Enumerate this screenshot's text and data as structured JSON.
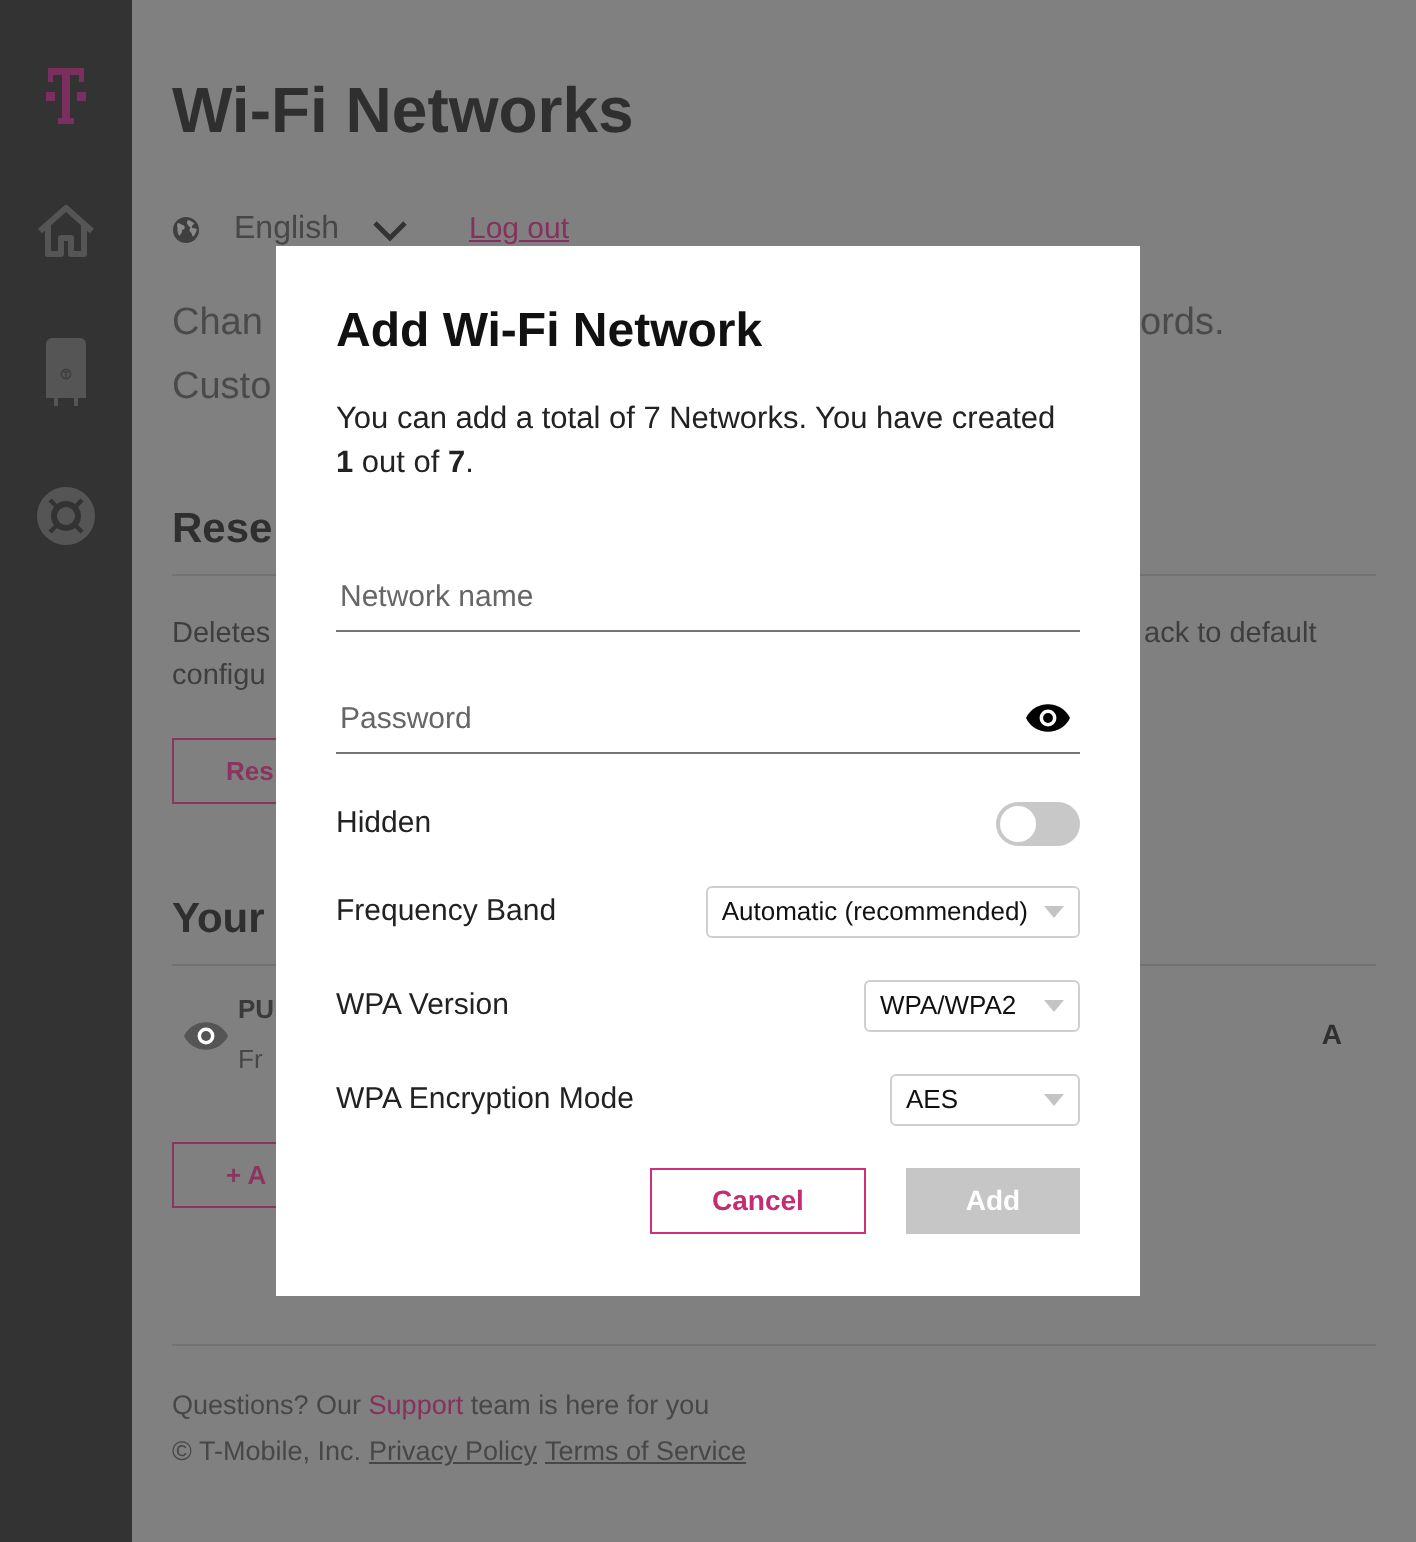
{
  "page_header": {
    "title": "Wi-Fi Networks",
    "language": "English",
    "logout_link": "Log out"
  },
  "background_content": {
    "intro_lines": [
      {
        "left": "Chan",
        "right": "ords."
      },
      {
        "left": "Custo"
      }
    ],
    "reset_section": {
      "heading": "Rese",
      "description_lines": [
        {
          "left": "Deletes",
          "right": "ack to default"
        },
        {
          "left": "configu"
        }
      ],
      "button": "Res"
    },
    "networks_section": {
      "heading": "Your",
      "networks": [
        {
          "name": "PU",
          "detail": "Fr",
          "column_3": "A"
        }
      ],
      "add_button": "+ A"
    }
  },
  "dialog": {
    "title": "Add Wi-Fi Network",
    "description": "You can add a total of 7 Networks. You have created **1** out of **7**.",
    "fields": [
      {
        "kind": "text",
        "placeholder": "Network name"
      },
      {
        "kind": "password",
        "placeholder": "Password"
      }
    ],
    "settings": [
      {
        "kind": "toggle",
        "label": "Hidden",
        "on": false
      },
      {
        "kind": "select",
        "label": "Frequency Band",
        "value": "Automatic (recommended)"
      },
      {
        "kind": "select",
        "label": "WPA Version",
        "value": "WPA/WPA2"
      },
      {
        "kind": "select",
        "label": "WPA Encryption Mode",
        "value": "AES"
      }
    ],
    "buttons": [
      {
        "kind": "secondary",
        "label": "Cancel",
        "disabled": false
      },
      {
        "kind": "primary",
        "label": "Add",
        "disabled": true
      }
    ]
  },
  "footer": {
    "support_line": {
      "before": "Questions? Our",
      "link": "Support",
      "after": "team is here for you"
    },
    "copyright": "© T-Mobile, Inc.",
    "links": [
      "Privacy Policy",
      "Terms of Service"
    ]
  }
}
